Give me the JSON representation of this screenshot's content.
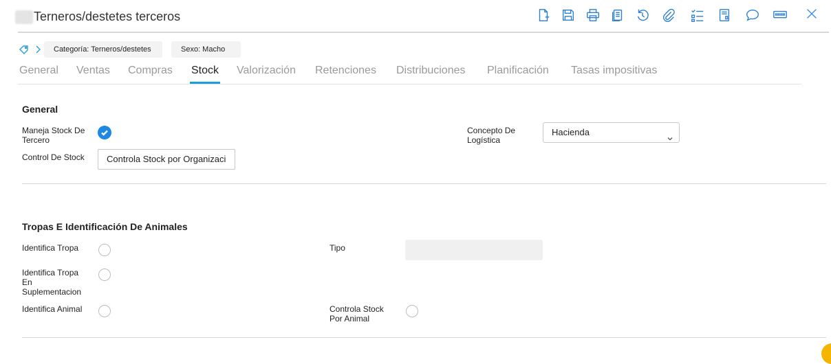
{
  "window": {
    "title": "Terneros/destetes terceros"
  },
  "toolbar": {
    "icons": [
      "new-document-icon",
      "save-icon",
      "print-icon",
      "copy-icon",
      "history-icon",
      "attachment-icon",
      "checklist-icon",
      "report-icon",
      "comment-icon",
      "barcode-icon",
      "close-icon"
    ]
  },
  "breadcrumb": {
    "chips": [
      "Categoría: Terneros/destetes",
      "Sexo: Macho"
    ]
  },
  "tabs": [
    "General",
    "Ventas",
    "Compras",
    "Stock",
    "Valorización",
    "Retenciones",
    "Distribuciones",
    "Planificación",
    "Tasas impositivas"
  ],
  "active_tab": "Stock",
  "general": {
    "title": "General",
    "maneja_stock_label": "Maneja Stock De Tercero",
    "maneja_stock_value": true,
    "control_stock_label": "Control De Stock",
    "control_stock_value": "Controla Stock por Organizaci",
    "concepto_label": "Concepto De Logística",
    "concepto_value": "Hacienda"
  },
  "tropas": {
    "title": "Tropas E Identificación De Animales",
    "identifica_tropa_label": "Identifica Tropa",
    "identifica_tropa_supl_label": "Identifica Tropa En Suplementacion",
    "identifica_animal_label": "Identifica Animal",
    "tipo_label": "Tipo",
    "tipo_value": "",
    "controla_stock_animal_label": "Controla Stock Por Animal"
  },
  "colors": {
    "accent": "#1aa0d8",
    "icon_blue": "#2a7fd4",
    "check_blue": "#1e88e5"
  }
}
